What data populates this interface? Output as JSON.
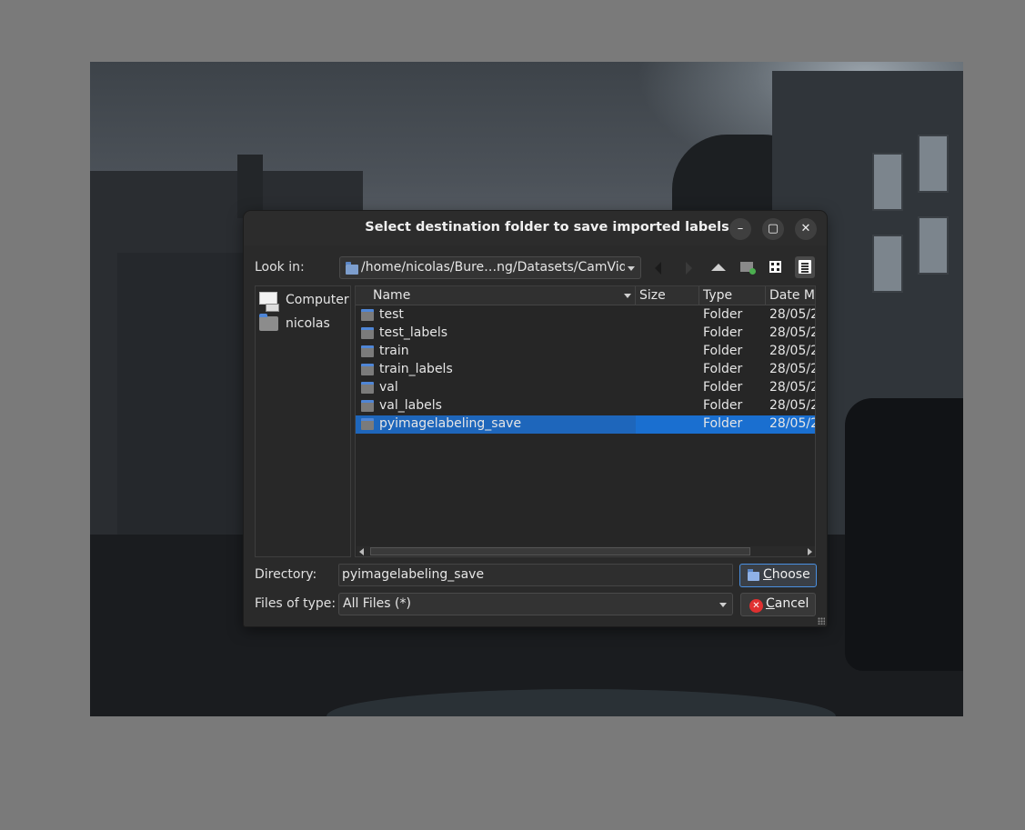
{
  "window": {
    "title": "Select destination folder to save imported labels",
    "minimize_glyph": "–",
    "maximize_glyph": "▢",
    "close_glyph": "✕"
  },
  "look_in": {
    "label": "Look in:",
    "path": "/home/nicolas/Bure…ng/Datasets/CamVid"
  },
  "sidebar": {
    "items": [
      {
        "label": "Computer",
        "icon": "computer-icon"
      },
      {
        "label": "nicolas",
        "icon": "home-folder-icon"
      }
    ]
  },
  "file_list": {
    "columns": {
      "name": "Name",
      "size": "Size",
      "type": "Type",
      "date": "Date Mo"
    },
    "rows": [
      {
        "name": "test",
        "type": "Folder",
        "date": "28/05/2"
      },
      {
        "name": "test_labels",
        "type": "Folder",
        "date": "28/05/2"
      },
      {
        "name": "train",
        "type": "Folder",
        "date": "28/05/2"
      },
      {
        "name": "train_labels",
        "type": "Folder",
        "date": "28/05/2"
      },
      {
        "name": "val",
        "type": "Folder",
        "date": "28/05/2"
      },
      {
        "name": "val_labels",
        "type": "Folder",
        "date": "28/05/2"
      },
      {
        "name": "pyimagelabeling_save",
        "type": "Folder",
        "date": "28/05/2",
        "selected": true
      }
    ]
  },
  "directory": {
    "label": "Directory:",
    "value": "pyimagelabeling_save"
  },
  "filetype": {
    "label": "Files of type:",
    "value": "All Files (*)"
  },
  "buttons": {
    "choose_first": "C",
    "choose_rest": "hoose",
    "cancel_first": "C",
    "cancel_rest": "ancel"
  },
  "colors": {
    "selection": "#1a6fd0",
    "dialog_bg": "#2a2a2a",
    "focus_border": "#4a90e2",
    "cancel_red": "#e03030"
  }
}
